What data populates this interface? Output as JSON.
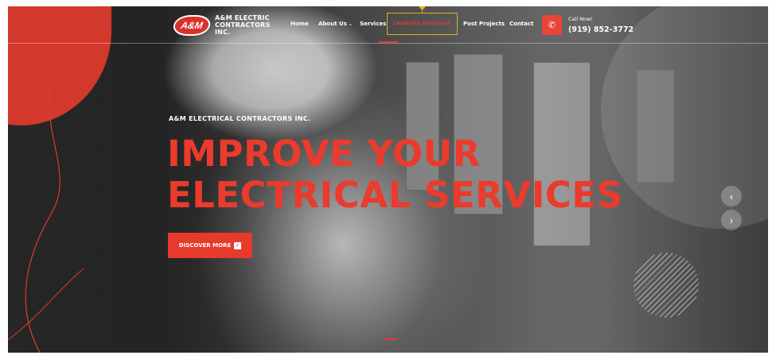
{
  "logo": {
    "mark": "A&M",
    "line1": "A&M ELECTRIC",
    "line2": "CONTRACTORS INC."
  },
  "nav": {
    "items": [
      {
        "label": "Home",
        "has_dropdown": false,
        "active": false
      },
      {
        "label": "About Us",
        "has_dropdown": true,
        "active": false
      },
      {
        "label": "Services",
        "has_dropdown": false,
        "active": false
      },
      {
        "label": "Capability Statement",
        "has_dropdown": false,
        "active": true
      },
      {
        "label": "Post Projects",
        "has_dropdown": false,
        "active": false
      },
      {
        "label": "Contact",
        "has_dropdown": false,
        "active": false
      }
    ],
    "chevron_glyph": "⌄"
  },
  "call": {
    "label": "Call Now!",
    "phone": "(919) 852-3772",
    "icon": "phone-icon",
    "icon_glyph": "✆"
  },
  "hero": {
    "eyebrow": "A&M ELECTRICAL CONTRACTORS INC.",
    "headline_line1": "IMPROVE YOUR",
    "headline_line2": "ELECTRICAL SERVICES",
    "cta_label": "DISCOVER MORE",
    "cta_icon": "check-square-icon",
    "cta_icon_glyph": "✓"
  },
  "slider": {
    "prev_glyph": "‹",
    "next_glyph": "›"
  },
  "colors": {
    "accent": "#e63a2d",
    "highlight": "#d9b21b"
  }
}
